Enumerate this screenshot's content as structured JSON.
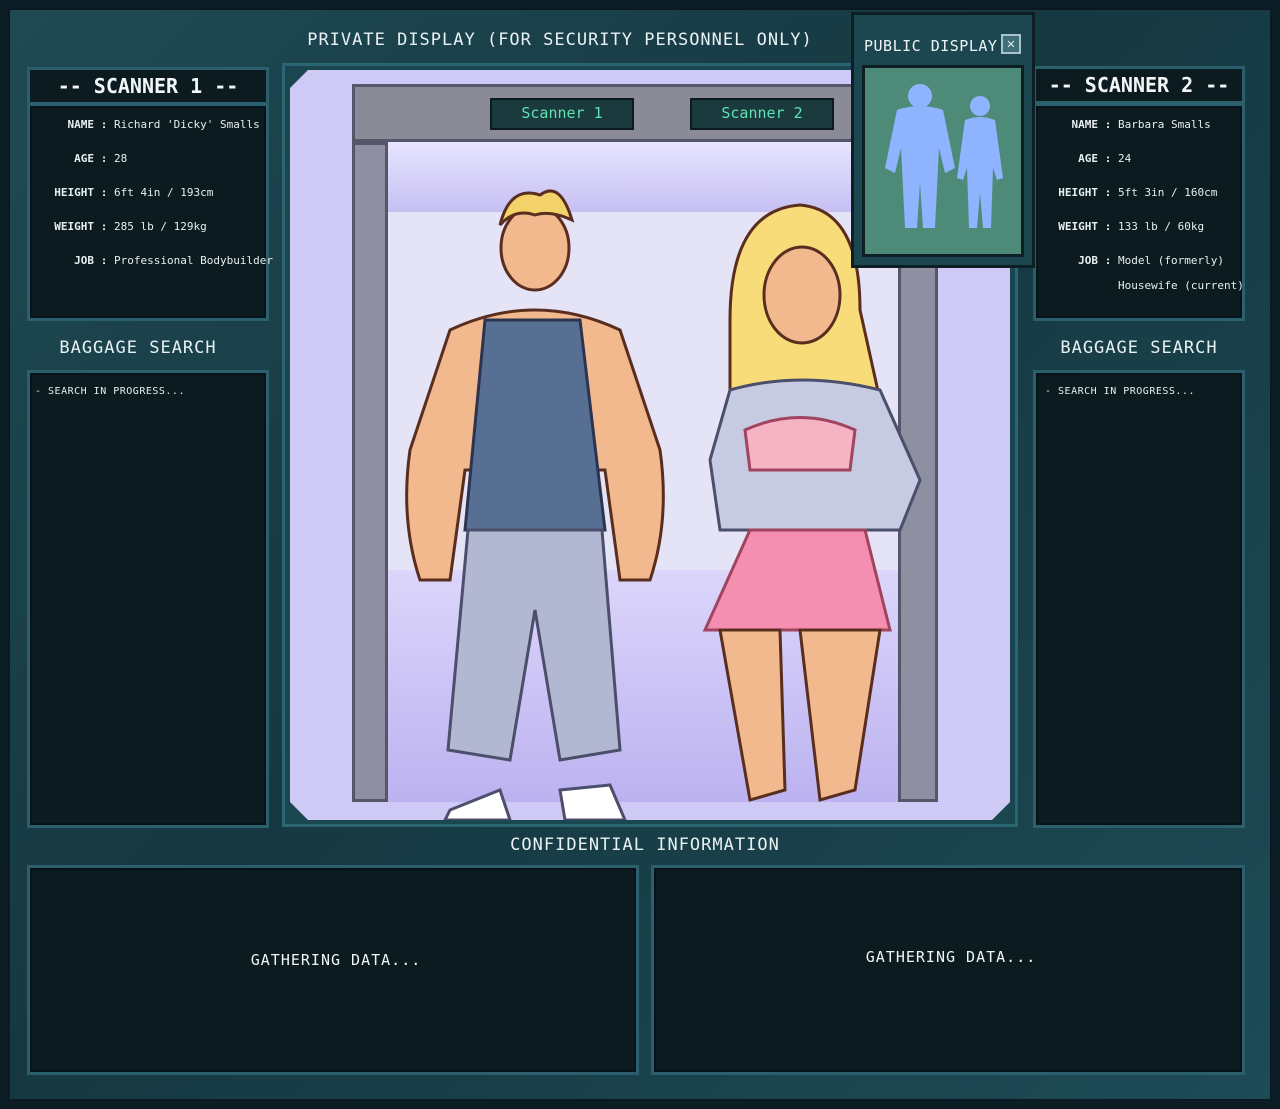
{
  "header": {
    "private_display": "PRIVATE DISPLAY (FOR SECURITY PERSONNEL ONLY)"
  },
  "public_display": {
    "title": "PUBLIC DISPLAY",
    "close_glyph": "✕"
  },
  "scene": {
    "sign_left": "Scanner 1",
    "sign_right": "Scanner 2"
  },
  "scanner1": {
    "title": "-- SCANNER 1 --",
    "rows": [
      {
        "k": "NAME",
        "v": "Richard 'Dicky' Smalls"
      },
      {
        "k": "AGE",
        "v": "28"
      },
      {
        "k": "HEIGHT",
        "v": "6ft 4in / 193cm"
      },
      {
        "k": "WEIGHT",
        "v": "285 lb / 129kg"
      },
      {
        "k": "JOB",
        "v": "Professional Bodybuilder"
      }
    ],
    "baggage_title": "BAGGAGE SEARCH",
    "baggage_status": "- SEARCH IN PROGRESS..."
  },
  "scanner2": {
    "title": "-- SCANNER 2 --",
    "rows": [
      {
        "k": "NAME",
        "v": "Barbara Smalls"
      },
      {
        "k": "AGE",
        "v": "24"
      },
      {
        "k": "HEIGHT",
        "v": "5ft 3in / 160cm"
      },
      {
        "k": "WEIGHT",
        "v": "133 lb / 60kg"
      },
      {
        "k": "JOB",
        "v": "Model (formerly)"
      }
    ],
    "job_extra": "Housewife (current)",
    "baggage_title": "BAGGAGE SEARCH",
    "baggage_status": "- SEARCH IN PROGRESS..."
  },
  "confidential": {
    "title": "CONFIDENTIAL INFORMATION",
    "left_status": "GATHERING DATA...",
    "right_status": "GATHERING DATA..."
  },
  "colors": {
    "frame": "#1f4a54",
    "panel": "#0b1b20",
    "border": "#2a5f6b",
    "sign_text": "#5fe3b4",
    "silhouette": "#8fb4ff",
    "public_screen": "#4d8a77"
  }
}
